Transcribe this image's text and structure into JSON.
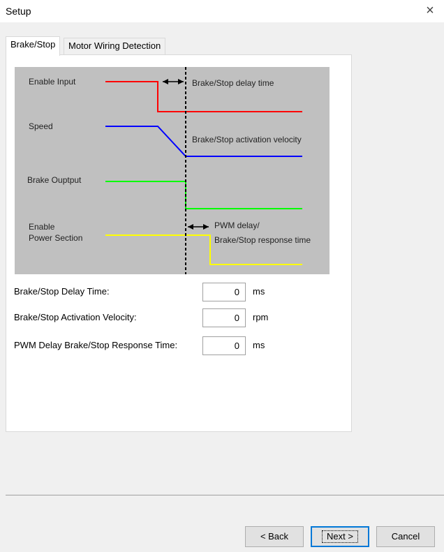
{
  "window": {
    "title": "Setup",
    "close_glyph": "×"
  },
  "tabs": [
    {
      "label": "Brake/Stop",
      "active": true
    },
    {
      "label": "Motor Wiring Detection",
      "active": false
    }
  ],
  "diagram": {
    "signals": [
      "Enable Input",
      "Speed",
      "Brake Ouptput",
      "Enable\nPower Section"
    ],
    "annotations": [
      "Brake/Stop delay time",
      "Brake/Stop activation velocity",
      "PWM delay/",
      "Brake/Stop response time"
    ],
    "colors": {
      "background": "#c0c0c0",
      "enable_input": "#ff0000",
      "speed": "#0000ff",
      "brake_output": "#00ff00",
      "enable_power": "#ffff00",
      "marker": "#000000"
    }
  },
  "fields": [
    {
      "label": "Brake/Stop Delay Time:",
      "value": "0",
      "unit": "ms"
    },
    {
      "label": "Brake/Stop Activation Velocity:",
      "value": "0",
      "unit": "rpm"
    },
    {
      "label": "PWM Delay Brake/Stop Response Time:",
      "value": "0",
      "unit": "ms"
    }
  ],
  "buttons": {
    "back": "< Back",
    "next": "Next >",
    "cancel": "Cancel"
  }
}
